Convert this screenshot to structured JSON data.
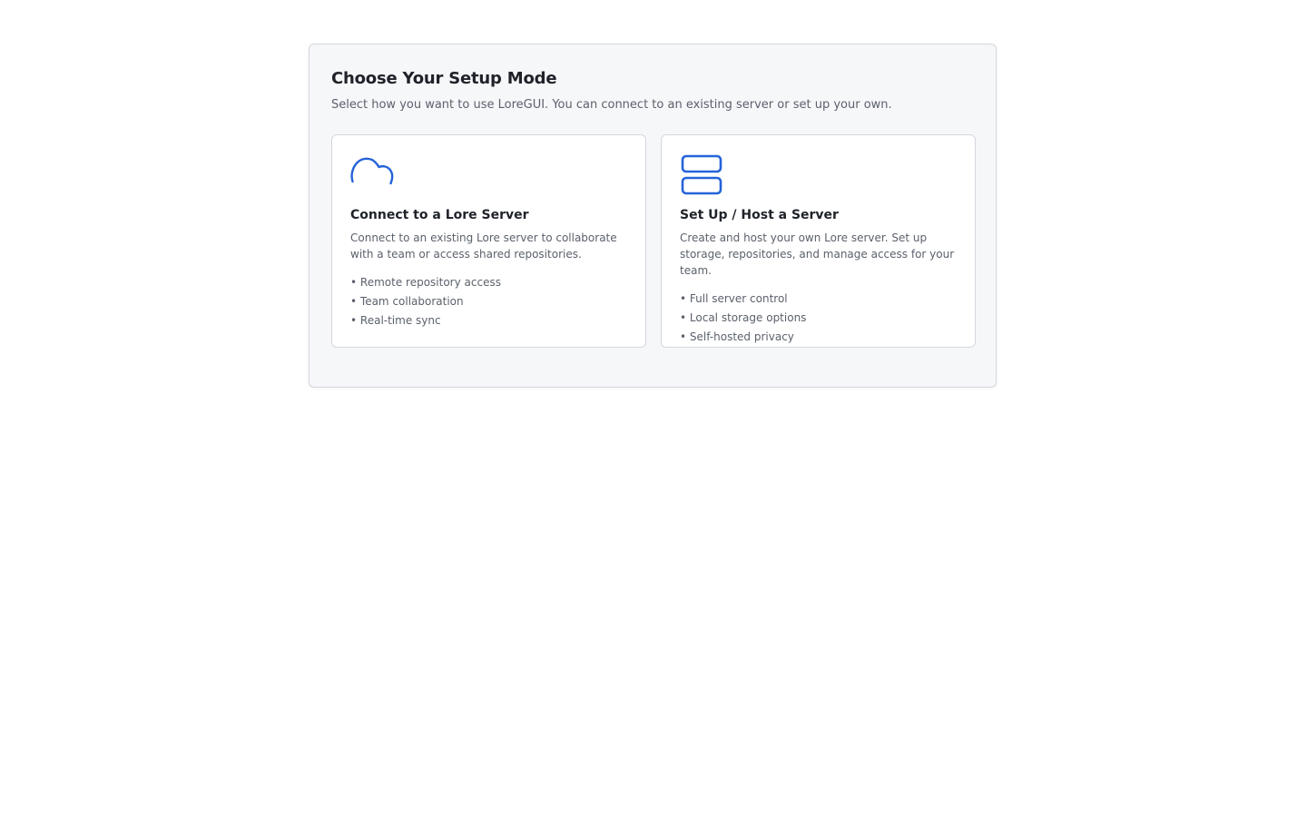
{
  "panel": {
    "title": "Choose Your Setup Mode",
    "subtitle": "Select how you want to use LoreGUI. You can connect to an existing server or set up your own."
  },
  "cards": [
    {
      "icon": "cloud-icon",
      "title": "Connect to a Lore Server",
      "description": "Connect to an existing Lore server to collaborate with a team or access shared repositories.",
      "features": [
        "Remote repository access",
        "Team collaboration",
        "Real-time sync"
      ]
    },
    {
      "icon": "server-icon",
      "title": "Set Up / Host a Server",
      "description": "Create and host your own Lore server. Set up storage, repositories, and manage access for your team.",
      "features": [
        "Full server control",
        "Local storage options",
        "Self-hosted privacy"
      ]
    }
  ],
  "colors": {
    "accent": "#2563d9",
    "panel_bg": "#f6f7f9",
    "border": "#d4d7dd",
    "title_text": "#1f2329",
    "muted_text": "#5b616b"
  }
}
